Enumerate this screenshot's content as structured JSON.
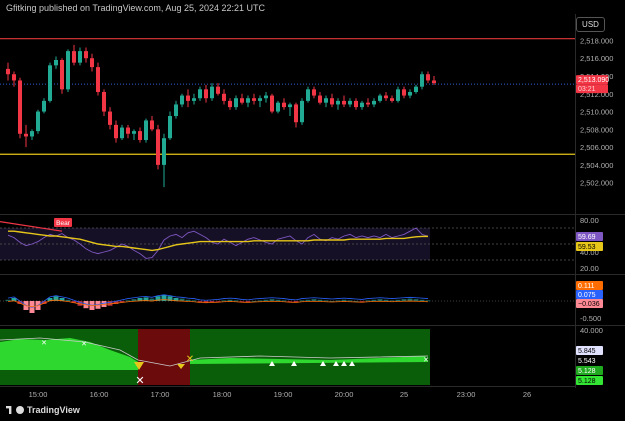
{
  "header": {
    "text": "Gfitking published on TradingView.com, Aug 25, 2024 22:21 UTC"
  },
  "currency": "USD",
  "brand": "TradingView",
  "colors": {
    "up": "#22ab94",
    "up_bright": "#26a69a",
    "down": "#f23645",
    "red_line": "#e03a3a",
    "yellow_line": "#e6c619",
    "price_line": "#3060d0"
  },
  "chart_data": [
    {
      "type": "candlestick",
      "panel": "price",
      "x_ticks": [
        "15:00",
        "16:00",
        "17:00",
        "18:00",
        "19:00",
        "20:00",
        "25",
        "23:00",
        "26"
      ],
      "y_ticks": [
        "2,518.000",
        "2,516.000",
        "2,514.000",
        "2,512.000",
        "2,510.000",
        "2,508.000",
        "2,506.000",
        "2,504.000",
        "2,502.000"
      ],
      "ylim": [
        2500.5,
        2518.5
      ],
      "last_price": "2,513.090",
      "countdown": "03:21",
      "levels": [
        2518.2,
        2505.2
      ],
      "ohlc": [
        [
          2514.8,
          2515.5,
          2513.5,
          2514.2
        ],
        [
          2514.2,
          2514.5,
          2512.8,
          2513.5
        ],
        [
          2513.5,
          2513.8,
          2507.0,
          2507.5
        ],
        [
          2507.5,
          2508.5,
          2506.0,
          2507.2
        ],
        [
          2507.2,
          2508.0,
          2506.8,
          2507.8
        ],
        [
          2507.8,
          2510.2,
          2507.5,
          2510.0
        ],
        [
          2510.0,
          2511.5,
          2509.8,
          2511.2
        ],
        [
          2511.2,
          2515.5,
          2511.0,
          2515.2
        ],
        [
          2515.2,
          2516.2,
          2514.8,
          2515.8
        ],
        [
          2515.8,
          2516.0,
          2512.0,
          2512.5
        ],
        [
          2512.5,
          2517.0,
          2512.2,
          2516.8
        ],
        [
          2516.8,
          2517.5,
          2515.2,
          2515.5
        ],
        [
          2515.5,
          2517.2,
          2515.2,
          2516.8
        ],
        [
          2516.8,
          2517.2,
          2515.5,
          2516.0
        ],
        [
          2516.0,
          2516.5,
          2514.5,
          2515.0
        ],
        [
          2515.0,
          2515.5,
          2511.8,
          2512.2
        ],
        [
          2512.2,
          2512.5,
          2509.5,
          2510.0
        ],
        [
          2510.0,
          2510.5,
          2508.0,
          2508.5
        ],
        [
          2508.5,
          2509.0,
          2506.5,
          2507.0
        ],
        [
          2507.0,
          2508.5,
          2506.8,
          2508.2
        ],
        [
          2508.2,
          2508.5,
          2507.0,
          2507.5
        ],
        [
          2507.5,
          2508.0,
          2506.8,
          2507.8
        ],
        [
          2507.8,
          2508.2,
          2506.5,
          2506.8
        ],
        [
          2506.8,
          2509.2,
          2506.5,
          2509.0
        ],
        [
          2509.0,
          2509.5,
          2507.8,
          2508.0
        ],
        [
          2508.0,
          2508.5,
          2503.5,
          2504.0
        ],
        [
          2504.0,
          2507.5,
          2501.5,
          2507.0
        ],
        [
          2507.0,
          2510.0,
          2506.8,
          2509.5
        ],
        [
          2509.5,
          2511.2,
          2509.2,
          2510.8
        ],
        [
          2510.8,
          2512.0,
          2510.5,
          2511.8
        ],
        [
          2511.8,
          2512.5,
          2510.5,
          2511.2
        ],
        [
          2511.2,
          2512.0,
          2510.8,
          2511.5
        ],
        [
          2511.5,
          2512.8,
          2511.2,
          2512.5
        ],
        [
          2512.5,
          2513.0,
          2511.0,
          2511.5
        ],
        [
          2511.5,
          2513.2,
          2511.2,
          2512.8
        ],
        [
          2512.8,
          2513.2,
          2511.8,
          2512.0
        ],
        [
          2512.0,
          2512.5,
          2510.8,
          2511.2
        ],
        [
          2511.2,
          2511.5,
          2510.2,
          2510.5
        ],
        [
          2510.5,
          2511.8,
          2510.2,
          2511.5
        ],
        [
          2511.5,
          2512.0,
          2510.8,
          2511.0
        ],
        [
          2511.0,
          2511.8,
          2510.5,
          2511.5
        ],
        [
          2511.5,
          2512.0,
          2510.8,
          2511.2
        ],
        [
          2511.2,
          2511.8,
          2510.5,
          2511.5
        ],
        [
          2511.5,
          2512.2,
          2511.0,
          2511.8
        ],
        [
          2511.8,
          2512.0,
          2509.8,
          2510.0
        ],
        [
          2510.0,
          2511.2,
          2509.8,
          2511.0
        ],
        [
          2511.0,
          2511.5,
          2510.2,
          2510.5
        ],
        [
          2510.5,
          2511.0,
          2509.5,
          2510.8
        ],
        [
          2510.8,
          2511.0,
          2508.2,
          2508.8
        ],
        [
          2508.8,
          2511.5,
          2508.5,
          2511.2
        ],
        [
          2511.2,
          2512.8,
          2511.0,
          2512.5
        ],
        [
          2512.5,
          2512.8,
          2511.5,
          2511.8
        ],
        [
          2511.8,
          2512.2,
          2510.8,
          2511.0
        ],
        [
          2511.0,
          2511.8,
          2510.5,
          2511.5
        ],
        [
          2511.5,
          2512.0,
          2510.5,
          2510.8
        ],
        [
          2510.8,
          2511.5,
          2510.2,
          2511.2
        ],
        [
          2511.2,
          2511.8,
          2510.5,
          2510.8
        ],
        [
          2510.8,
          2511.5,
          2510.5,
          2511.2
        ],
        [
          2511.2,
          2511.5,
          2510.2,
          2510.5
        ],
        [
          2510.5,
          2511.2,
          2510.2,
          2511.0
        ],
        [
          2511.0,
          2511.5,
          2510.5,
          2510.8
        ],
        [
          2510.8,
          2511.5,
          2510.5,
          2511.2
        ],
        [
          2511.2,
          2512.0,
          2511.0,
          2511.8
        ],
        [
          2511.8,
          2512.2,
          2511.2,
          2511.5
        ],
        [
          2511.5,
          2511.8,
          2511.0,
          2511.2
        ],
        [
          2511.2,
          2512.8,
          2511.0,
          2512.5
        ],
        [
          2512.5,
          2512.8,
          2511.5,
          2511.8
        ],
        [
          2511.8,
          2512.5,
          2511.5,
          2512.2
        ],
        [
          2512.2,
          2513.0,
          2512.0,
          2512.8
        ],
        [
          2512.8,
          2514.5,
          2512.5,
          2514.2
        ],
        [
          2514.2,
          2514.5,
          2513.2,
          2513.5
        ],
        [
          2513.5,
          2514.0,
          2513.0,
          2513.2
        ]
      ]
    },
    {
      "type": "line",
      "panel": "rsi",
      "y_ticks": [
        "80.00",
        "40.00",
        "20.00"
      ],
      "ylim": [
        15,
        85
      ],
      "series": [
        {
          "name": "rsi",
          "values": [
            61,
            58,
            52,
            48,
            50,
            53,
            58,
            62,
            60,
            63,
            58,
            55,
            50,
            44,
            40,
            38,
            40,
            42,
            46,
            50,
            47,
            42,
            38,
            32,
            33,
            42,
            55,
            60,
            62,
            58,
            64,
            66,
            62,
            58,
            52,
            50,
            56,
            52,
            48,
            52,
            56,
            58,
            55,
            52,
            50,
            56,
            58,
            60,
            54,
            50,
            58,
            62,
            56,
            54,
            58,
            56,
            60,
            62,
            58,
            60,
            58,
            60,
            58,
            62,
            58,
            60,
            62,
            66,
            70,
            62,
            59.69
          ],
          "label": "59.69"
        },
        {
          "name": "signal",
          "values": [
            66,
            66,
            65,
            64,
            63,
            62,
            61,
            60,
            60,
            59,
            58,
            57,
            56,
            54,
            52,
            50,
            49,
            48,
            47,
            47,
            46,
            45,
            44,
            43,
            42,
            43,
            45,
            47,
            49,
            50,
            51,
            52,
            53,
            53,
            53,
            53,
            53,
            53,
            53,
            53,
            53,
            54,
            54,
            54,
            54,
            54,
            54,
            54,
            54,
            54,
            54,
            55,
            55,
            55,
            55,
            55,
            55,
            56,
            56,
            56,
            56,
            56,
            56,
            57,
            57,
            57,
            57,
            58,
            59,
            59.5,
            59.53
          ],
          "label": "59.53"
        }
      ],
      "tag": "Bear"
    },
    {
      "type": "histogram",
      "panel": "macd",
      "y_ticks": [
        "-0.500"
      ],
      "ylim": [
        -0.4,
        0.3
      ],
      "values": [
        0.02,
        0.05,
        -0.05,
        -0.15,
        -0.2,
        -0.15,
        -0.05,
        0.05,
        0.08,
        0.05,
        0.02,
        -0.03,
        -0.08,
        -0.12,
        -0.15,
        -0.13,
        -0.1,
        -0.08,
        -0.05,
        -0.02,
        0.01,
        0.03,
        0.05,
        0.06,
        0.04,
        0.08,
        0.1,
        0.08,
        0.05,
        0.04,
        0.02,
        0.01,
        -0.02,
        -0.03,
        -0.02,
        -0.01,
        0.01,
        0.02,
        0.01,
        -0.01,
        -0.02,
        0.0,
        0.01,
        0.02,
        0.03,
        0.02,
        0.01,
        -0.01,
        -0.02,
        0.01,
        0.02,
        0.03,
        0.02,
        0.01,
        0.0,
        0.01,
        0.02,
        0.01,
        0.0,
        -0.01,
        0.01,
        0.02,
        0.03,
        0.02,
        0.01,
        0.02,
        0.03,
        0.04,
        0.03,
        0.02,
        0.01
      ],
      "labels": [
        "0.111",
        "0.075",
        "−0.036"
      ]
    },
    {
      "type": "area",
      "panel": "trend",
      "y_ticks": [
        "40.000"
      ],
      "labels": [
        "5.845",
        "5.543",
        "5.128",
        "5.128"
      ]
    }
  ]
}
